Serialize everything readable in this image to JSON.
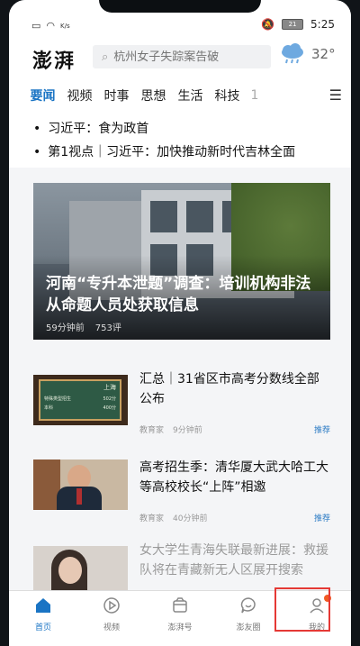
{
  "status_bar": {
    "left_text": "K/s",
    "time": "5:25",
    "battery": "21"
  },
  "header": {
    "logo": "澎湃",
    "search_placeholder": "杭州女子失踪案告破",
    "temperature": "32°"
  },
  "tabs": [
    {
      "label": "要闻",
      "active": true
    },
    {
      "label": "视频"
    },
    {
      "label": "时事"
    },
    {
      "label": "思想"
    },
    {
      "label": "生活"
    },
    {
      "label": "科技"
    },
    {
      "label": "1"
    }
  ],
  "headlines": [
    "习近平：食为政首",
    "第1视点｜习近平：加快推动新时代吉林全面"
  ],
  "hero": {
    "title": "河南“专升本泄题”调查：培训机构非法从命题人员处获取信息",
    "time": "59分钟前",
    "comments": "753评"
  },
  "cards": [
    {
      "title": "汇总｜31省区市高考分数线全部公布",
      "source": "教育家",
      "time": "9分钟前",
      "tag": "推荐",
      "thumb_text": [
        "上海",
        "特殊类型招生",
        "502分",
        "本科",
        "400分"
      ]
    },
    {
      "title": "高考招生季：清华厦大武大哈工大等高校校长“上阵”相邀",
      "source": "教育家",
      "time": "40分钟前",
      "tag": "推荐"
    },
    {
      "title": "女大学生青海失联最新进展：救援队将在青藏新无人区展开搜索"
    }
  ],
  "bottom_nav": [
    {
      "label": "首页",
      "icon": "home-icon",
      "active": true
    },
    {
      "label": "视频",
      "icon": "video-icon"
    },
    {
      "label": "澎湃号",
      "icon": "pengpai-hao-icon"
    },
    {
      "label": "澎友圈",
      "icon": "chat-icon"
    },
    {
      "label": "我的",
      "icon": "profile-icon"
    }
  ],
  "colors": {
    "accent": "#1a74c4",
    "highlight": "#e53935",
    "badge": "#f15a24"
  }
}
